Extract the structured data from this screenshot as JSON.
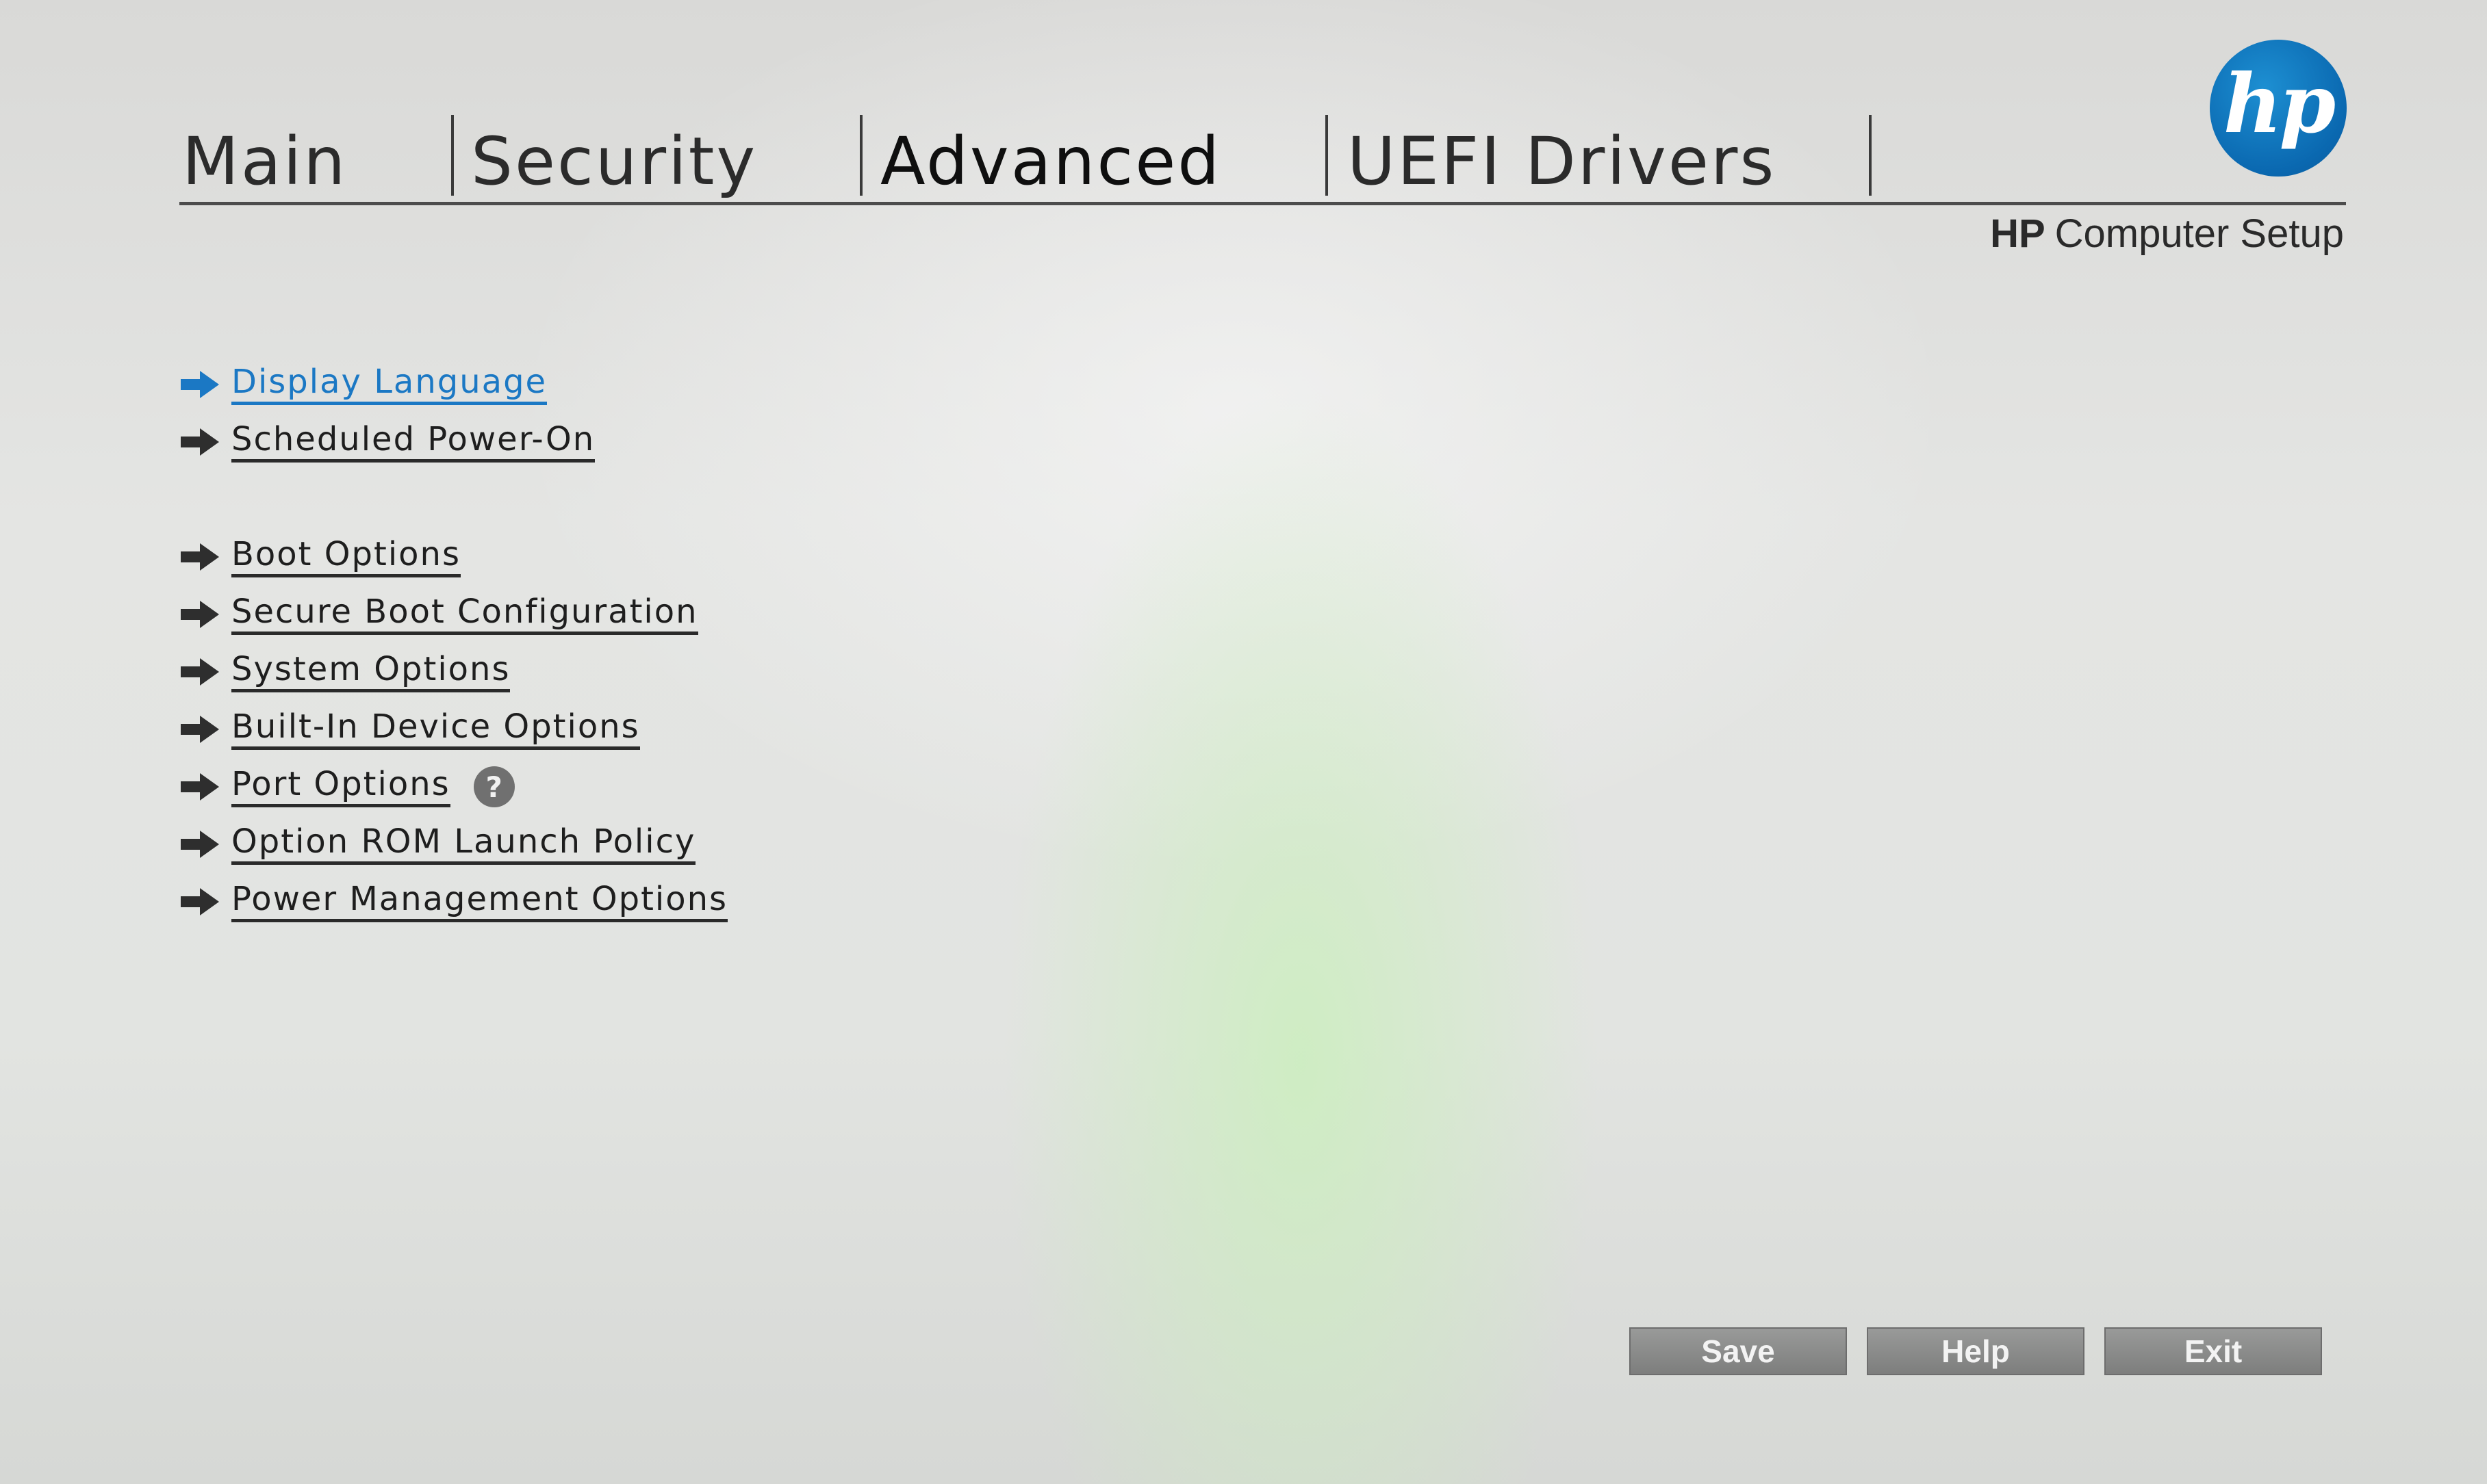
{
  "header": {
    "tabs": [
      {
        "label": "Main",
        "active": false
      },
      {
        "label": "Security",
        "active": false
      },
      {
        "label": "Advanced",
        "active": true
      },
      {
        "label": "UEFI Drivers",
        "active": false
      }
    ],
    "logo_text": "hp",
    "title_brand": "HP",
    "title_text": "Computer Setup"
  },
  "menu": {
    "items": [
      {
        "label": "Display Language",
        "selected": true
      },
      {
        "label": "Scheduled Power-On",
        "selected": false
      },
      {
        "label": "Boot Options",
        "selected": false
      },
      {
        "label": "Secure Boot Configuration",
        "selected": false
      },
      {
        "label": "System Options",
        "selected": false
      },
      {
        "label": "Built-In Device Options",
        "selected": false
      },
      {
        "label": "Port Options",
        "selected": false,
        "help_icon": "?"
      },
      {
        "label": "Option ROM Launch Policy",
        "selected": false
      },
      {
        "label": "Power Management Options",
        "selected": false
      }
    ]
  },
  "footer": {
    "save_label": "Save",
    "help_label": "Help",
    "exit_label": "Exit"
  },
  "colors": {
    "accent": "#1b78c4",
    "logo_blue": "#0a68b0",
    "button_gray": "#8a8b8a"
  }
}
